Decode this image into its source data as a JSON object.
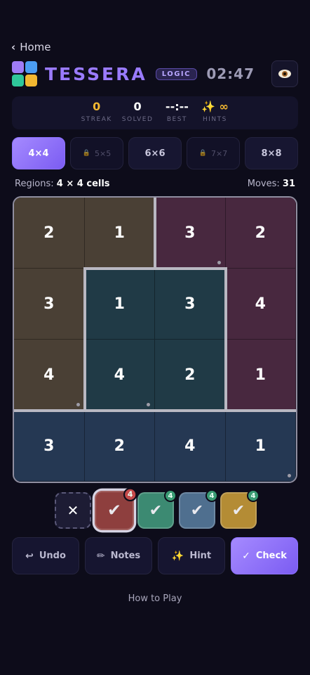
{
  "nav": {
    "back_label": "Home"
  },
  "header": {
    "title": "TESSERA",
    "badge": "LOGIC",
    "timer": "02:47",
    "logo_colors": [
      "#9f7cf5",
      "#4b9df2",
      "#2fc79a",
      "#f2b731"
    ]
  },
  "stats": [
    {
      "value": "0",
      "label": "STREAK",
      "color": "#f2b731"
    },
    {
      "value": "0",
      "label": "SOLVED",
      "color": "#ffffff"
    },
    {
      "value": "--:--",
      "label": "BEST",
      "color": "#ffffff"
    },
    {
      "value": "✨ ∞",
      "label": "HINTS",
      "color": "#f2b731"
    }
  ],
  "sizes": [
    {
      "label": "4×4",
      "state": "active"
    },
    {
      "label": "5×5",
      "state": "locked"
    },
    {
      "label": "6×6",
      "state": "normal"
    },
    {
      "label": "7×7",
      "state": "locked"
    },
    {
      "label": "8×8",
      "state": "normal"
    }
  ],
  "info": {
    "regions_label": "Regions:",
    "regions_value": "4 × 4 cells",
    "moves_label": "Moves:",
    "moves_value": "31"
  },
  "board": {
    "rows": 4,
    "cols": 4,
    "values": [
      [
        2,
        1,
        3,
        2
      ],
      [
        3,
        1,
        3,
        4
      ],
      [
        4,
        4,
        2,
        1
      ],
      [
        3,
        2,
        4,
        1
      ]
    ],
    "regions": [
      [
        0,
        0,
        1,
        1
      ],
      [
        0,
        2,
        2,
        1
      ],
      [
        0,
        2,
        2,
        1
      ],
      [
        3,
        3,
        3,
        3
      ]
    ],
    "region_colors": [
      "#4a4035",
      "#48283f",
      "#203a46",
      "#253853"
    ],
    "dots": [
      [
        0,
        2
      ],
      [
        2,
        0
      ],
      [
        2,
        1
      ],
      [
        3,
        3
      ]
    ]
  },
  "palette": [
    {
      "type": "clear",
      "color": "#1d1c34"
    },
    {
      "type": "color",
      "color": "#8e3f3e",
      "count": "4",
      "selected": true
    },
    {
      "type": "color",
      "color": "#3c8a72",
      "count": "4",
      "selected": false
    },
    {
      "type": "color",
      "color": "#4f6f8f",
      "count": "4",
      "selected": false
    },
    {
      "type": "color",
      "color": "#b48c35",
      "count": "4",
      "selected": false
    }
  ],
  "actions": [
    {
      "label": "Undo",
      "icon": "undo-icon",
      "glyph": "↩"
    },
    {
      "label": "Notes",
      "icon": "pencil-icon",
      "glyph": "✏"
    },
    {
      "label": "Hint",
      "icon": "sparkle-icon",
      "glyph": "✨"
    },
    {
      "label": "Check",
      "icon": "check-icon",
      "glyph": "✓",
      "primary": true
    }
  ],
  "footer": {
    "how_to_play": "How to Play"
  }
}
